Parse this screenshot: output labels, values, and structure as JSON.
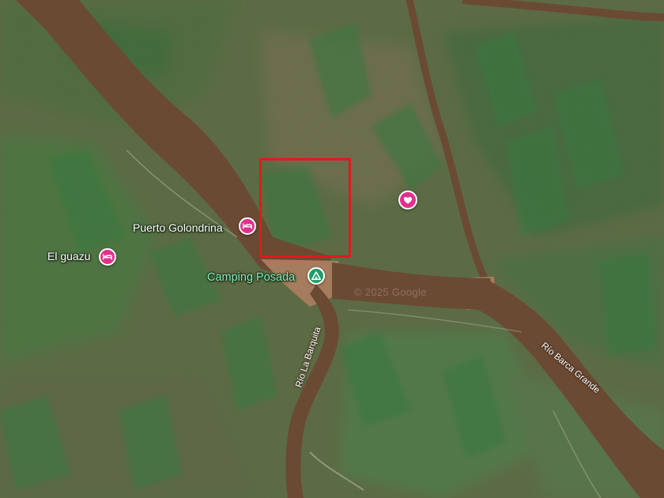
{
  "map": {
    "watermark": "© 2025 Google",
    "colors": {
      "river": "#6b4a33",
      "sandbank": "#a57c5e",
      "marsh_green": "#3f7a3f",
      "dry_land": "#6a6a48",
      "selection_outline": "#e0191f",
      "lodging_pin": "#e1318a",
      "camping_pin": "#1e9e6a"
    }
  },
  "places": [
    {
      "id": "puerto-golondrina",
      "label": "Puerto Golondrina",
      "icon": "bed-icon",
      "category": "lodging"
    },
    {
      "id": "el-guazu",
      "label": "El guazu",
      "icon": "bed-icon",
      "category": "lodging"
    },
    {
      "id": "camping-posada",
      "label": "Camping Posada",
      "icon": "tent-icon",
      "category": "camping"
    },
    {
      "id": "saved-place",
      "label": "",
      "icon": "heart-icon",
      "category": "saved"
    }
  ],
  "rivers": [
    {
      "id": "rio-la-barquita",
      "label": "Río La Barquita"
    },
    {
      "id": "rio-barca-grande",
      "label": "Río Barca Grande"
    }
  ]
}
